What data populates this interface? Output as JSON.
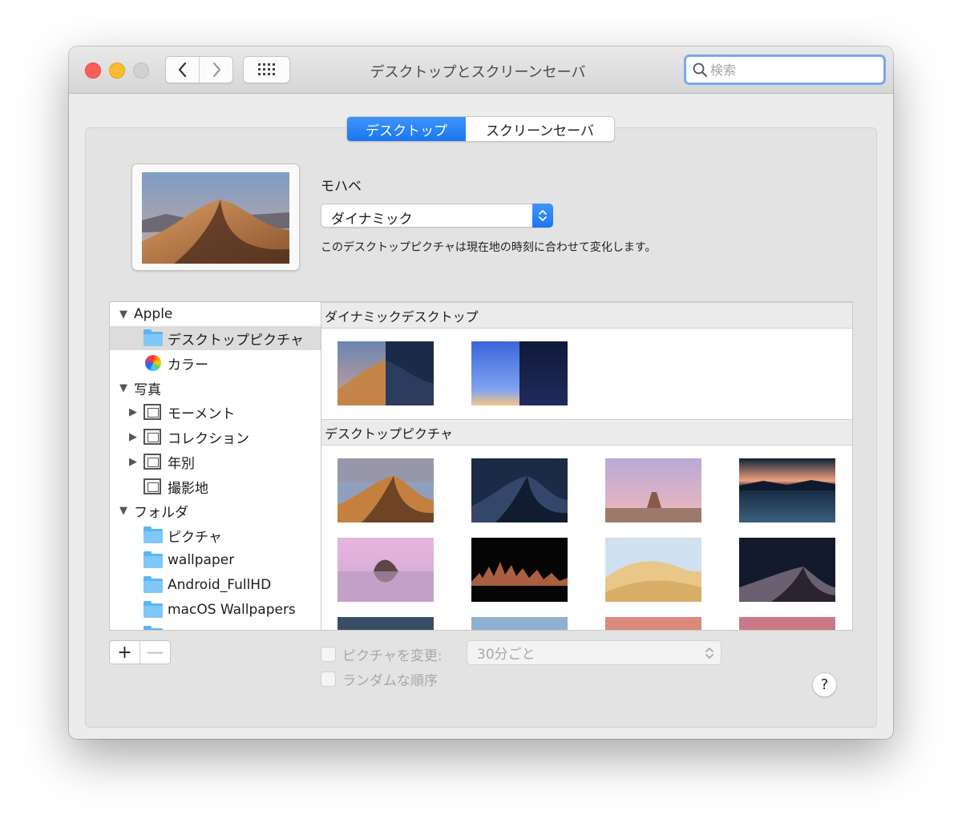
{
  "window": {
    "title": "デスクトップとスクリーンセーバ",
    "search_placeholder": "検索"
  },
  "tabs": [
    {
      "label": "デスクトップ",
      "selected": true
    },
    {
      "label": "スクリーンセーバ",
      "selected": false
    }
  ],
  "current": {
    "name": "モハベ",
    "mode": "ダイナミック",
    "description": "このデスクトップピクチャは現在地の時刻に合わせて変化します。"
  },
  "sidebar": {
    "apple": {
      "label": "Apple",
      "items": [
        {
          "label": "デスクトップピクチャ",
          "selected": true
        },
        {
          "label": "カラー"
        }
      ]
    },
    "photos": {
      "label": "写真",
      "items": [
        {
          "label": "モーメント"
        },
        {
          "label": "コレクション"
        },
        {
          "label": "年別"
        },
        {
          "label": "撮影地"
        }
      ]
    },
    "folders": {
      "label": "フォルダ",
      "items": [
        {
          "label": "ピクチャ"
        },
        {
          "label": "wallpaper"
        },
        {
          "label": "Android_FullHD"
        },
        {
          "label": "macOS Wallpapers"
        }
      ]
    }
  },
  "sections": {
    "dynamic": "ダイナミックデスクトップ",
    "pictures": "デスクトップピクチャ"
  },
  "options": {
    "change_picture": "ピクチャを変更:",
    "interval": "30分ごと",
    "random_order": "ランダムな順序"
  },
  "buttons": {
    "add": "+",
    "remove": "—",
    "help": "?"
  },
  "colors": {
    "accent": "#1a76f0",
    "folder": "#5bb5f0"
  }
}
